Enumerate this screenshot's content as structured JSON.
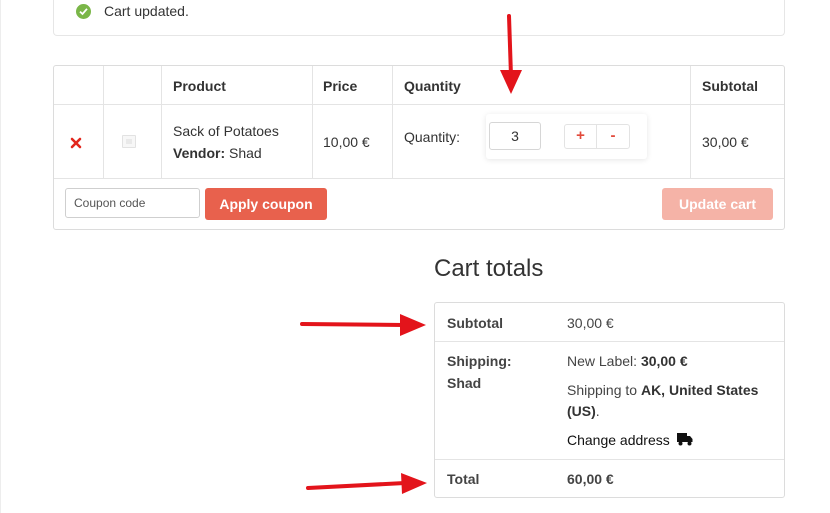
{
  "notice": {
    "message": "Cart updated."
  },
  "cart_table": {
    "headers": {
      "product": "Product",
      "price": "Price",
      "quantity": "Quantity",
      "subtotal": "Subtotal"
    },
    "row": {
      "product_name": "Sack of Potatoes",
      "vendor_label": "Vendor:",
      "vendor_name": "Shad",
      "price": "10,00 €",
      "quantity_label": "Quantity:",
      "quantity_value": "3",
      "plus_label": "+",
      "minus_label": "-",
      "subtotal": "30,00 €"
    },
    "coupon": {
      "placeholder": "Coupon code",
      "value": ""
    },
    "apply_coupon_label": "Apply coupon",
    "update_cart_label": "Update cart"
  },
  "cart_totals": {
    "title": "Cart totals",
    "subtotal_label": "Subtotal",
    "subtotal_value": "30,00 €",
    "shipping_label_line1": "Shipping:",
    "shipping_label_line2": "Shad",
    "shipping_method_prefix": "New Label:",
    "shipping_method_price": "30,00 €",
    "shipping_to_prefix": "Shipping to",
    "shipping_to_place_line1": "AK, United States",
    "shipping_to_place_line2": "(US)",
    "shipping_to_suffix": ".",
    "change_address_label": "Change address",
    "total_label": "Total",
    "total_value": "60,00 €"
  },
  "colors": {
    "accent": "#e8614d",
    "accent_disabled": "#f5b3a7",
    "success": "#7ab648",
    "annotation_arrow": "#e3141b"
  },
  "icons": [
    "check-circle-icon",
    "remove-x-icon",
    "placeholder-image-icon",
    "truck-icon",
    "annotation-arrow"
  ]
}
